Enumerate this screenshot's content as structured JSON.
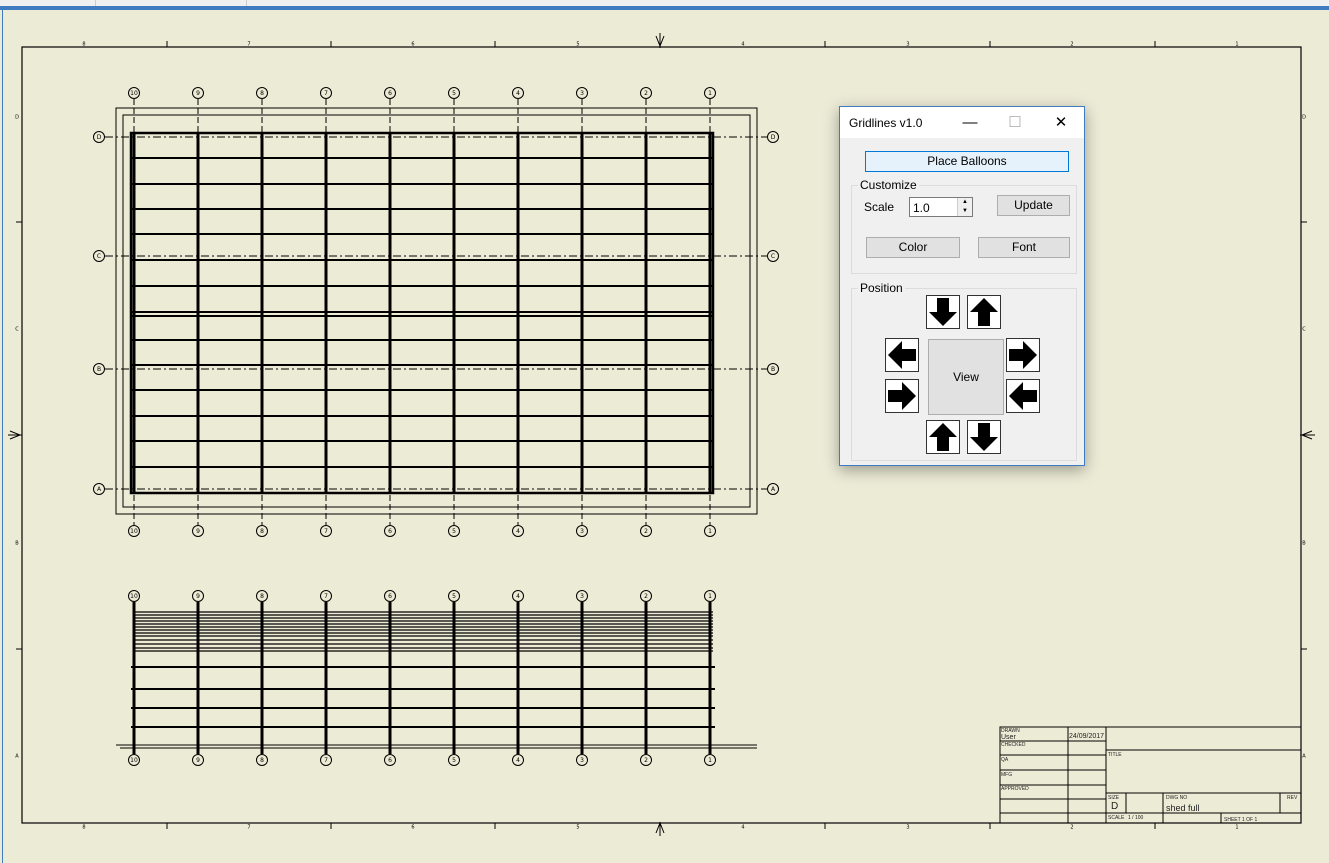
{
  "drawing": {
    "border_col_labels": [
      "8",
      "7",
      "6",
      "5",
      "4",
      "3",
      "2",
      "1"
    ],
    "border_row_labels": [
      "D",
      "C",
      "B",
      "A"
    ],
    "grid_columns": [
      "10",
      "9",
      "8",
      "7",
      "6",
      "5",
      "4",
      "3",
      "2",
      "1"
    ],
    "grid_rows": [
      "D",
      "C",
      "B",
      "A"
    ]
  },
  "title_block": {
    "drawn_label": "DRAWN",
    "drawn_by": "User",
    "date": "24/09/2017",
    "checked_label": "CHECKED",
    "qa_label": "QA",
    "mfg_label": "MFG",
    "approved_label": "APPROVED",
    "title_label": "TITLE",
    "size_label": "SIZE",
    "size": "D",
    "dwg_no_label": "DWG NO",
    "dwg_no": "shed full",
    "rev_label": "REV",
    "scale_label": "SCALE",
    "scale": "1 / 100",
    "sheet": "SHEET 1  OF 1"
  },
  "dialog": {
    "title": "Gridlines v1.0",
    "minimize": "—",
    "maximize": "☐",
    "close": "✕",
    "place_balloons": "Place Balloons",
    "customize_label": "Customize",
    "scale_label": "Scale",
    "scale_value": "1.0",
    "update": "Update",
    "color": "Color",
    "font": "Font",
    "position_label": "Position",
    "view": "View"
  },
  "colors": {
    "paper": "#ecebd6",
    "accent": "#3f7bc1"
  }
}
